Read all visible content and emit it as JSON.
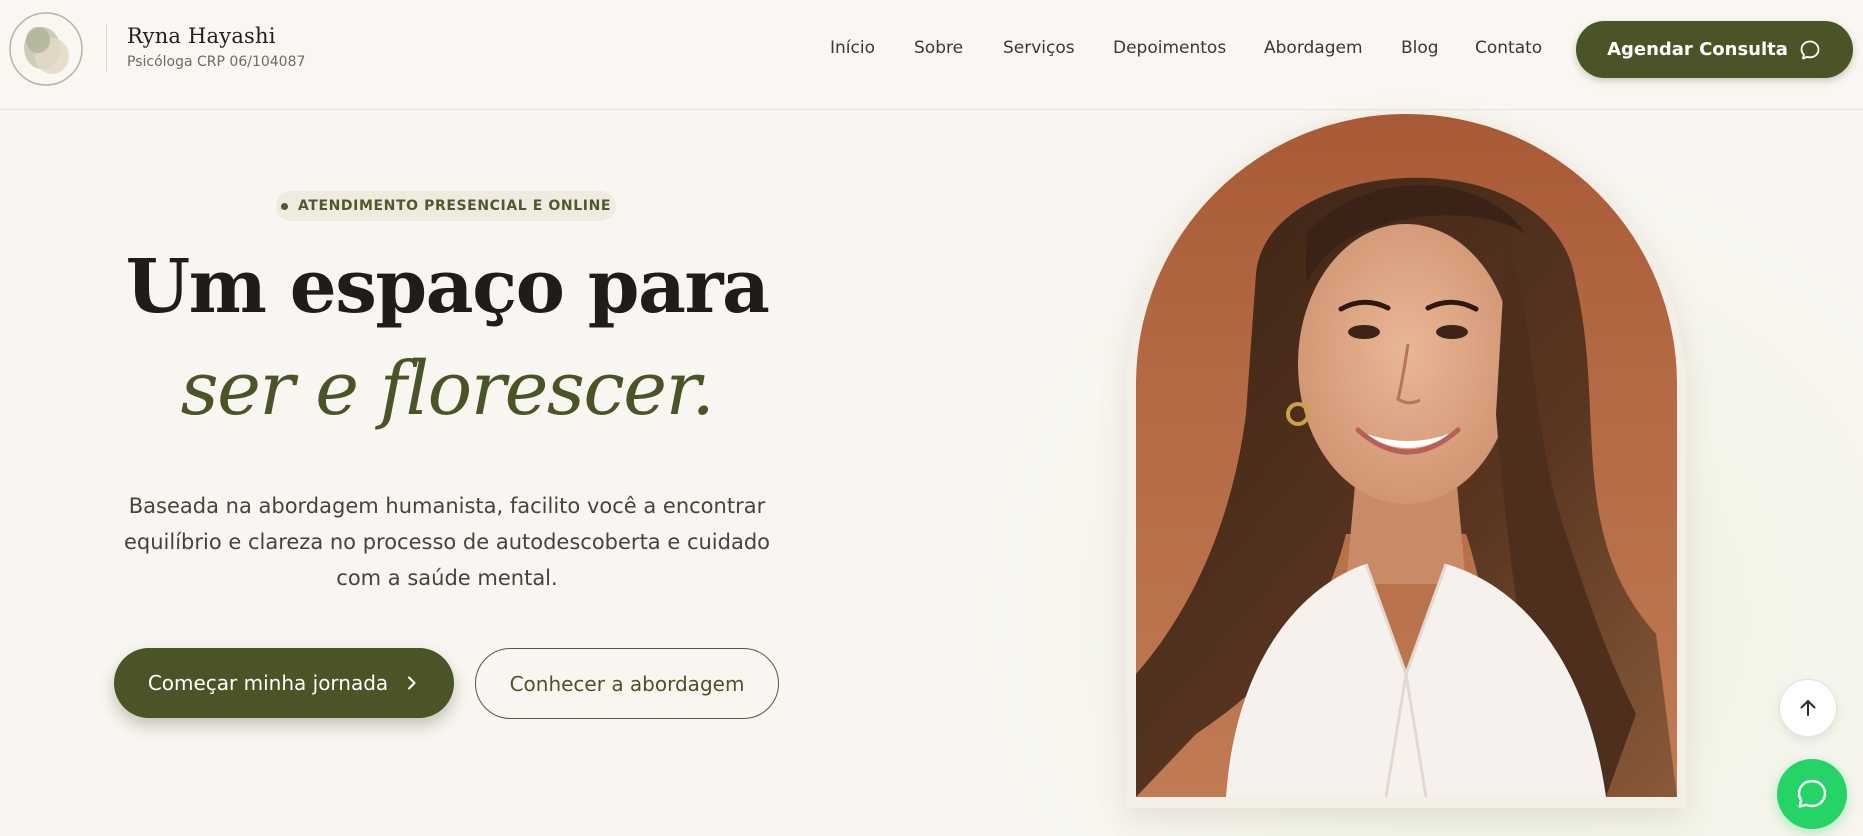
{
  "brand": {
    "name": "Ryna Hayashi",
    "subtitle": "Psicóloga CRP 06/104087"
  },
  "nav": {
    "items": [
      {
        "label": "Início"
      },
      {
        "label": "Sobre"
      },
      {
        "label": "Serviços"
      },
      {
        "label": "Depoimentos"
      },
      {
        "label": "Abordagem"
      },
      {
        "label": "Blog"
      },
      {
        "label": "Contato"
      }
    ],
    "cta_label": "Agendar Consulta",
    "cta_icon": "chat-bubble-icon"
  },
  "hero": {
    "badge": "ATENDIMENTO PRESENCIAL E ONLINE",
    "title_line1": "Um espaço para",
    "title_line2": "ser e florescer.",
    "description": "Baseada na abordagem humanista, facilito você a encontrar equilíbrio e clareza no processo de autodescoberta e cuidado com a saúde mental.",
    "primary_button": "Começar minha jornada",
    "secondary_button": "Conhecer a abordagem"
  },
  "floating": {
    "scroll_top_icon": "arrow-up-icon",
    "whatsapp_icon": "whatsapp-icon"
  },
  "colors": {
    "brand_green": "#4a5426",
    "background": "#f9f6f1",
    "whatsapp": "#25d366"
  }
}
